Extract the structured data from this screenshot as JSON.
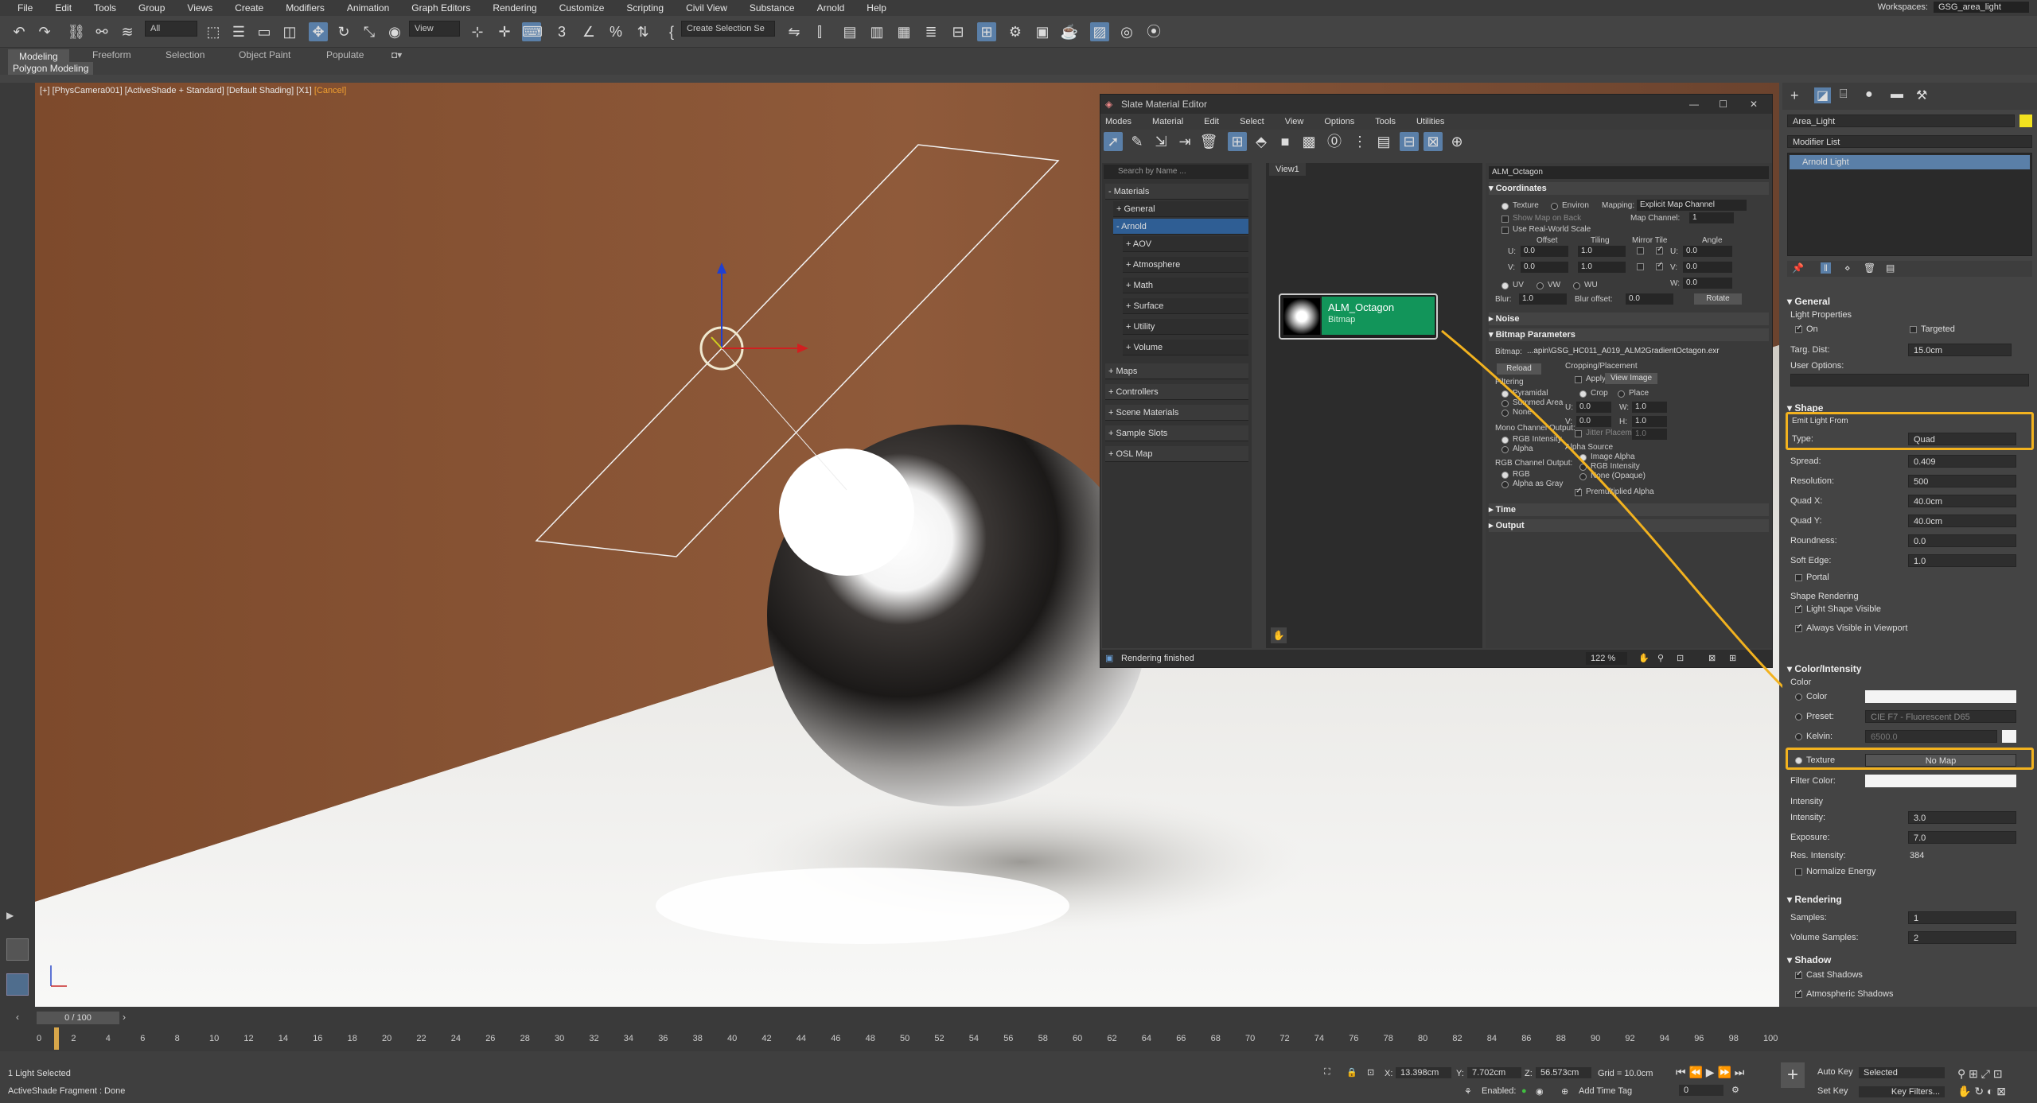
{
  "menubar": {
    "items": [
      "File",
      "Edit",
      "Tools",
      "Group",
      "Views",
      "Create",
      "Modifiers",
      "Animation",
      "Graph Editors",
      "Rendering",
      "Customize",
      "Scripting",
      "Civil View",
      "Substance",
      "Arnold",
      "Help"
    ],
    "workspace_label": "Workspaces:",
    "workspace_value": "GSG_area_light"
  },
  "toolbar": {
    "selection_filter": "All",
    "coord_system": "View",
    "named_selection": "Create Selection Se"
  },
  "ribbon": {
    "tabs": [
      "Modeling",
      "Freeform",
      "Selection",
      "Object Paint",
      "Populate"
    ],
    "sub_label": "Polygon Modeling"
  },
  "viewport": {
    "label": "[+] [PhysCamera001] [ActiveShade + Standard] [Default Shading] [X1]",
    "cancel": "[Cancel]"
  },
  "slate": {
    "title": "Slate Material Editor",
    "menu": [
      "Modes",
      "Material",
      "Edit",
      "Select",
      "View",
      "Options",
      "Tools",
      "Utilities"
    ],
    "search_placeholder": "Search by Name ...",
    "browser": {
      "materials": "- Materials",
      "general": "+ General",
      "arnold": "- Arnold",
      "arnold_items": [
        "+ AOV",
        "+ Atmosphere",
        "+ Math",
        "+ Surface",
        "+ Utility",
        "+ Volume"
      ],
      "groups": [
        "+ Maps",
        "+ Controllers",
        "+ Scene Materials",
        "+ Sample Slots",
        "+ OSL Map"
      ]
    },
    "view_tab": "View1",
    "node": {
      "name": "ALM_Octagon",
      "type": "Bitmap"
    },
    "params": {
      "map_name": "ALM_Octagon",
      "coordinates": "Coordinates",
      "texture": "Texture",
      "environ": "Environ",
      "mapping_label": "Mapping:",
      "mapping_value": "Explicit Map Channel",
      "show_map_on_back": "Show Map on Back",
      "map_channel_label": "Map Channel:",
      "map_channel_value": "1",
      "use_real_world": "Use Real-World Scale",
      "col_offset": "Offset",
      "col_tiling": "Tiling",
      "col_mirror_tile": "Mirror Tile",
      "col_angle": "Angle",
      "u_label": "U:",
      "v_label": "V:",
      "w_label": "W:",
      "u_offset": "0.0",
      "v_offset": "0.0",
      "u_tiling": "1.0",
      "v_tiling": "1.0",
      "u_angle": "0.0",
      "v_angle": "0.0",
      "w_angle": "0.0",
      "uv": "UV",
      "vw": "VW",
      "wu": "WU",
      "blur_label": "Blur:",
      "blur_value": "1.0",
      "blur_offset_label": "Blur offset:",
      "blur_offset_value": "0.0",
      "rotate": "Rotate",
      "noise": "Noise",
      "bitmap_params": "Bitmap Parameters",
      "bitmap_label": "Bitmap:",
      "bitmap_path": "...apin\\GSG_HC011_A019_ALM2GradientOctagon.exr",
      "reload": "Reload",
      "cropping": "Cropping/Placement",
      "apply": "Apply",
      "view_image": "View Image",
      "crop": "Crop",
      "place": "Place",
      "cu": "U:",
      "cu_val": "0.0",
      "cw": "W:",
      "cw_val": "1.0",
      "cv": "V:",
      "cv_val": "0.0",
      "ch": "H:",
      "ch_val": "1.0",
      "jitter": "Jitter Placement",
      "jitter_val": "1.0",
      "filtering": "Filtering",
      "pyramidal": "Pyramidal",
      "summed_area": "Summed Area",
      "none": "None",
      "mono_output": "Mono Channel Output:",
      "rgb_intensity": "RGB Intensity",
      "alpha": "Alpha",
      "rgb_output": "RGB Channel Output:",
      "rgb": "RGB",
      "alpha_as_gray": "Alpha as Gray",
      "alpha_source": "Alpha Source",
      "image_alpha": "Image Alpha",
      "rgb_intensity2": "RGB Intensity",
      "none_opaque": "None (Opaque)",
      "premult": "Premultiplied Alpha",
      "time": "Time",
      "output": "Output"
    },
    "status": "Rendering finished",
    "zoom": "122 %"
  },
  "command_panel": {
    "object_name": "Area_Light",
    "modifier_list": "Modifier List",
    "stack_item": "Arnold Light",
    "general": "General",
    "light_properties": "Light Properties",
    "on": "On",
    "targeted": "Targeted",
    "targ_dist_label": "Targ. Dist:",
    "targ_dist": "15.0cm",
    "user_options": "User Options:",
    "shape": "Shape",
    "emit_from": "Emit Light From",
    "type_label": "Type:",
    "type_value": "Quad",
    "spread_label": "Spread:",
    "spread": "0.409",
    "resolution_label": "Resolution:",
    "resolution": "500",
    "quadx_label": "Quad X:",
    "quadx": "40.0cm",
    "quady_label": "Quad Y:",
    "quady": "40.0cm",
    "roundness_label": "Roundness:",
    "roundness": "0.0",
    "softedge_label": "Soft Edge:",
    "softedge": "1.0",
    "portal": "Portal",
    "shape_rendering": "Shape Rendering",
    "light_shape_visible": "Light Shape Visible",
    "always_visible": "Always Visible in Viewport",
    "color_intensity": "Color/Intensity",
    "color_group": "Color",
    "color": "Color",
    "preset_label": "Preset:",
    "preset_value": "CIE F7 - Fluorescent D65",
    "kelvin_label": "Kelvin:",
    "kelvin_value": "6500.0",
    "texture": "Texture",
    "no_map": "No Map",
    "filter_color": "Filter Color:",
    "intensity_group": "Intensity",
    "intensity_label": "Intensity:",
    "intensity": "3.0",
    "exposure_label": "Exposure:",
    "exposure": "7.0",
    "res_intensity_label": "Res. Intensity:",
    "res_intensity": "384",
    "normalize": "Normalize Energy",
    "rendering": "Rendering",
    "samples_label": "Samples:",
    "samples": "1",
    "vol_samples_label": "Volume Samples:",
    "vol_samples": "2",
    "shadow": "Shadow",
    "cast_shadows": "Cast Shadows",
    "atmo_shadows": "Atmospheric Shadows",
    "accent": "#f2b21f"
  },
  "timeline": {
    "frame": "0 / 100",
    "ticks": [
      "0",
      "2",
      "4",
      "6",
      "8",
      "10",
      "12",
      "14",
      "16",
      "18",
      "20",
      "22",
      "24",
      "26",
      "28",
      "30",
      "32",
      "34",
      "36",
      "38",
      "40",
      "42",
      "44",
      "46",
      "48",
      "50",
      "52",
      "54",
      "56",
      "58",
      "60",
      "62",
      "64",
      "66",
      "68",
      "70",
      "72",
      "74",
      "76",
      "78",
      "80",
      "82",
      "84",
      "86",
      "88",
      "90",
      "92",
      "94",
      "96",
      "98",
      "100"
    ]
  },
  "status": {
    "selection": "1 Light Selected",
    "prompt": "ActiveShade Fragment : Done",
    "x": "13.398cm",
    "y": "7.702cm",
    "z": "56.573cm",
    "grid": "Grid = 10.0cm",
    "enabled": "Enabled:",
    "add_time_tag": "Add Time Tag",
    "auto_key": "Auto Key",
    "set_key": "Set Key",
    "selected": "Selected",
    "key_filters": "Key Filters...",
    "frame": "0"
  }
}
